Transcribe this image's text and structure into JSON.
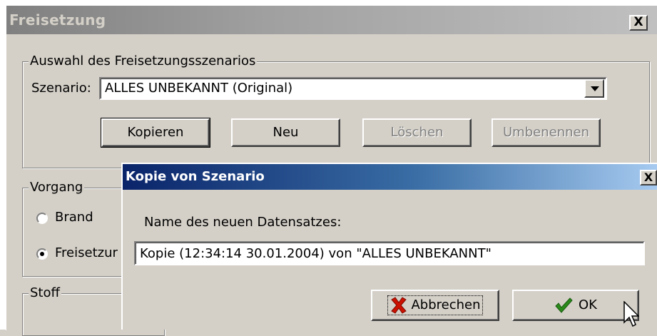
{
  "main_window": {
    "title": "Freisetzung",
    "close_label": "X",
    "scenario_group": {
      "legend": "Auswahl des Freisetzungsszenarios",
      "scenario_label": "Szenario:",
      "scenario_value": "ALLES UNBEKANNT (Original)",
      "buttons": {
        "copy": "Kopieren",
        "new": "Neu",
        "delete": "Löschen",
        "rename": "Umbenennen"
      }
    },
    "process_group": {
      "legend": "Vorgang",
      "options": [
        {
          "label": "Brand",
          "checked": false
        },
        {
          "label": "Freisetzur",
          "checked": true
        }
      ]
    },
    "substance_group": {
      "legend": "Stoff"
    }
  },
  "dialog": {
    "title": "Kopie von Szenario",
    "close_label": "X",
    "prompt": "Name des neuen Datensatzes:",
    "name_value": "Kopie (12:34:14 30.01.2004) von \"ALLES UNBEKANNT\"",
    "cancel_label": "Abbrechen",
    "ok_label": "OK",
    "icons": {
      "cancel": "red-x-icon",
      "ok": "green-check-icon"
    }
  },
  "colors": {
    "face": "#d4d0c8",
    "inactive_title": "#808080",
    "active_title_start": "#0a246a",
    "active_title_end": "#a6caf0",
    "cancel_icon": "#cc1100",
    "ok_icon": "#2a8a1a"
  }
}
